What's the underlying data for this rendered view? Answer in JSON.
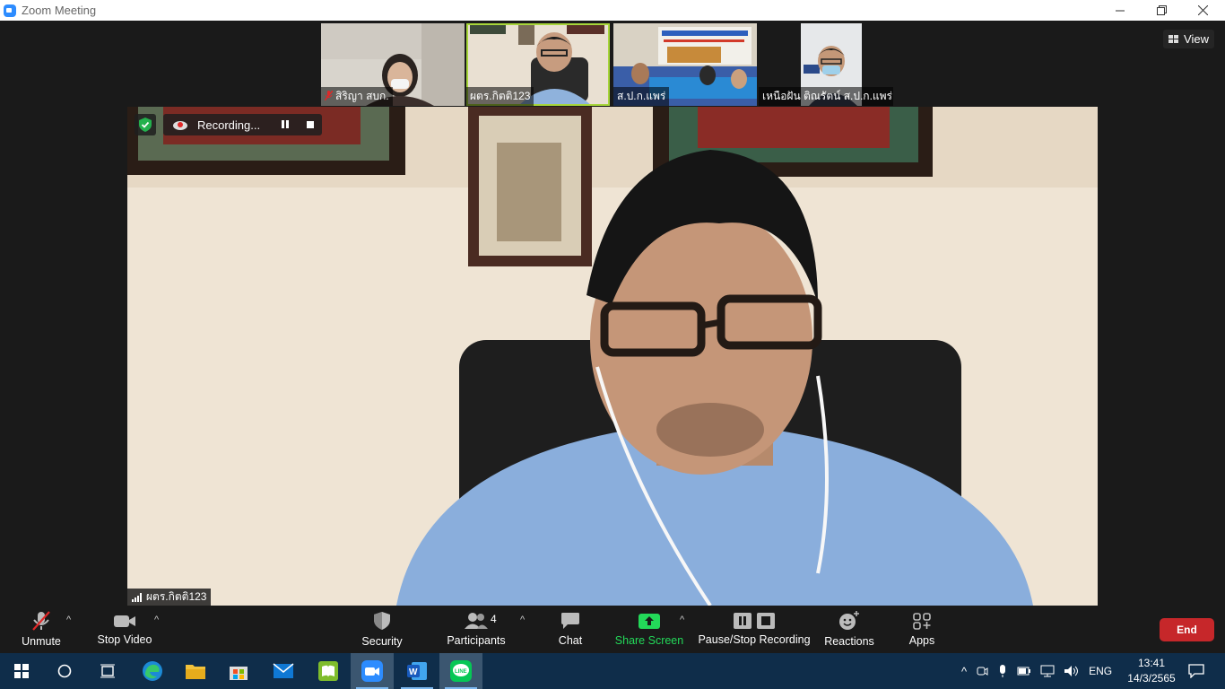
{
  "window": {
    "title": "Zoom Meeting"
  },
  "view_label": "View",
  "thumbnails": [
    {
      "name": "สิริญา สบก.",
      "muted": true
    },
    {
      "name": "ผตร.กิตติ123",
      "muted": false,
      "active": true
    },
    {
      "name": "ส.ป.ก.แพร่",
      "muted": false
    },
    {
      "name": "เหนือฝัน ติณรัตน์ ส.ป.ก.แพร่",
      "muted": false
    }
  ],
  "main_video": {
    "recording_label": "Recording...",
    "speaker_name": "ผตร.กิตติ123"
  },
  "toolbar": {
    "unmute": "Unmute",
    "stop_video": "Stop Video",
    "security": "Security",
    "participants": "Participants",
    "participants_count": "4",
    "chat": "Chat",
    "share_screen": "Share Screen",
    "pause_stop_recording": "Pause/Stop Recording",
    "reactions": "Reactions",
    "apps": "Apps",
    "end": "End"
  },
  "taskbar": {
    "language": "ENG",
    "time": "13:41",
    "date": "14/3/2565"
  },
  "colors": {
    "share_green": "#23d959",
    "end_red": "#c6272a",
    "active_speaker_border": "#a7d53a",
    "zoom_blue": "#2d8cff"
  }
}
